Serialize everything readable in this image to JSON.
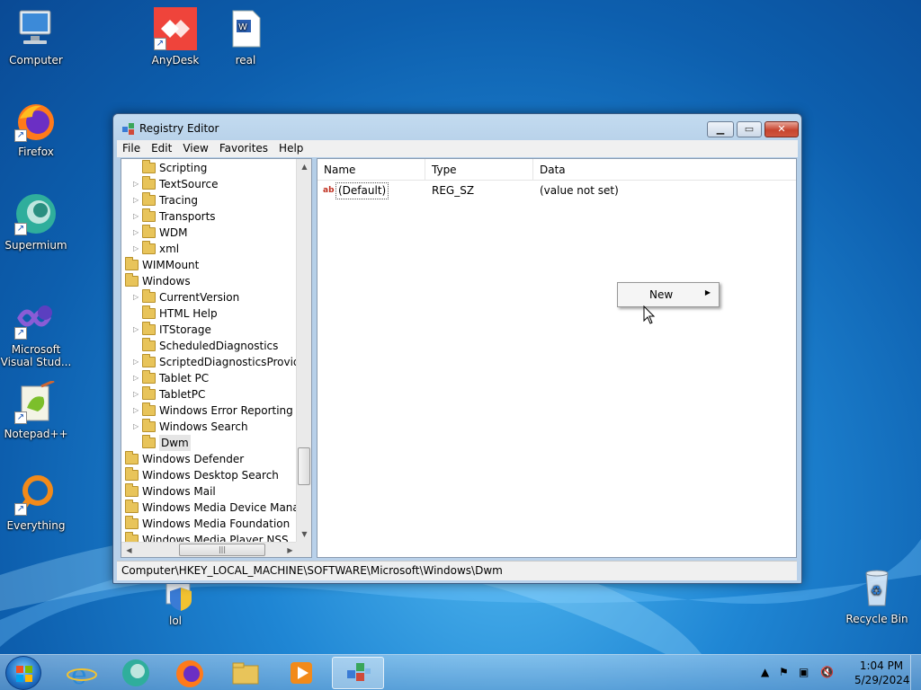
{
  "desktop": {
    "icons": {
      "computer": "Computer",
      "anydesk": "AnyDesk",
      "real": "real",
      "firefox": "Firefox",
      "supermium": "Supermium",
      "vs_line1": "Microsoft",
      "vs_line2": "Visual Stud...",
      "notepadpp": "Notepad++",
      "everything": "Everything",
      "lol": "lol",
      "recycle": "Recycle Bin"
    }
  },
  "window": {
    "title": "Registry Editor",
    "menu": [
      "File",
      "Edit",
      "View",
      "Favorites",
      "Help"
    ],
    "tree": [
      {
        "label": "Scripting",
        "level": 2,
        "arrow": false
      },
      {
        "label": "TextSource",
        "level": 2,
        "arrow": true
      },
      {
        "label": "Tracing",
        "level": 2,
        "arrow": true
      },
      {
        "label": "Transports",
        "level": 2,
        "arrow": true
      },
      {
        "label": "WDM",
        "level": 2,
        "arrow": true
      },
      {
        "label": "xml",
        "level": 2,
        "arrow": true
      },
      {
        "label": "WIMMount",
        "level": 1,
        "arrow": false
      },
      {
        "label": "Windows",
        "level": 1,
        "arrow": false
      },
      {
        "label": "CurrentVersion",
        "level": 2,
        "arrow": true
      },
      {
        "label": "HTML Help",
        "level": 2,
        "arrow": false
      },
      {
        "label": "ITStorage",
        "level": 2,
        "arrow": true
      },
      {
        "label": "ScheduledDiagnostics",
        "level": 2,
        "arrow": false
      },
      {
        "label": "ScriptedDiagnosticsProvider",
        "level": 2,
        "arrow": true
      },
      {
        "label": "Tablet PC",
        "level": 2,
        "arrow": true
      },
      {
        "label": "TabletPC",
        "level": 2,
        "arrow": true
      },
      {
        "label": "Windows Error Reporting",
        "level": 2,
        "arrow": true
      },
      {
        "label": "Windows Search",
        "level": 2,
        "arrow": true
      },
      {
        "label": "Dwm",
        "level": 2,
        "arrow": false,
        "selected": true
      },
      {
        "label": "Windows Defender",
        "level": 1,
        "arrow": false
      },
      {
        "label": "Windows Desktop Search",
        "level": 1,
        "arrow": false
      },
      {
        "label": "Windows Mail",
        "level": 1,
        "arrow": false
      },
      {
        "label": "Windows Media Device Manager",
        "level": 1,
        "arrow": false
      },
      {
        "label": "Windows Media Foundation",
        "level": 1,
        "arrow": false
      },
      {
        "label": "Windows Media Player NSS",
        "level": 1,
        "arrow": false
      }
    ],
    "list": {
      "headers": {
        "name": "Name",
        "type": "Type",
        "data": "Data"
      },
      "rows": [
        {
          "icon": "ab",
          "name": "(Default)",
          "type": "REG_SZ",
          "data": "(value not set)"
        }
      ]
    },
    "status_path": "Computer\\HKEY_LOCAL_MACHINE\\SOFTWARE\\Microsoft\\Windows\\Dwm",
    "context_menu": {
      "new_label": "New"
    }
  },
  "taskbar": {
    "clock_time": "1:04 PM",
    "clock_date": "5/29/2024"
  },
  "colors": {
    "desktop_bg": "#1f86d4",
    "folder": "#e8c45a",
    "close_button": "#c7452f"
  }
}
